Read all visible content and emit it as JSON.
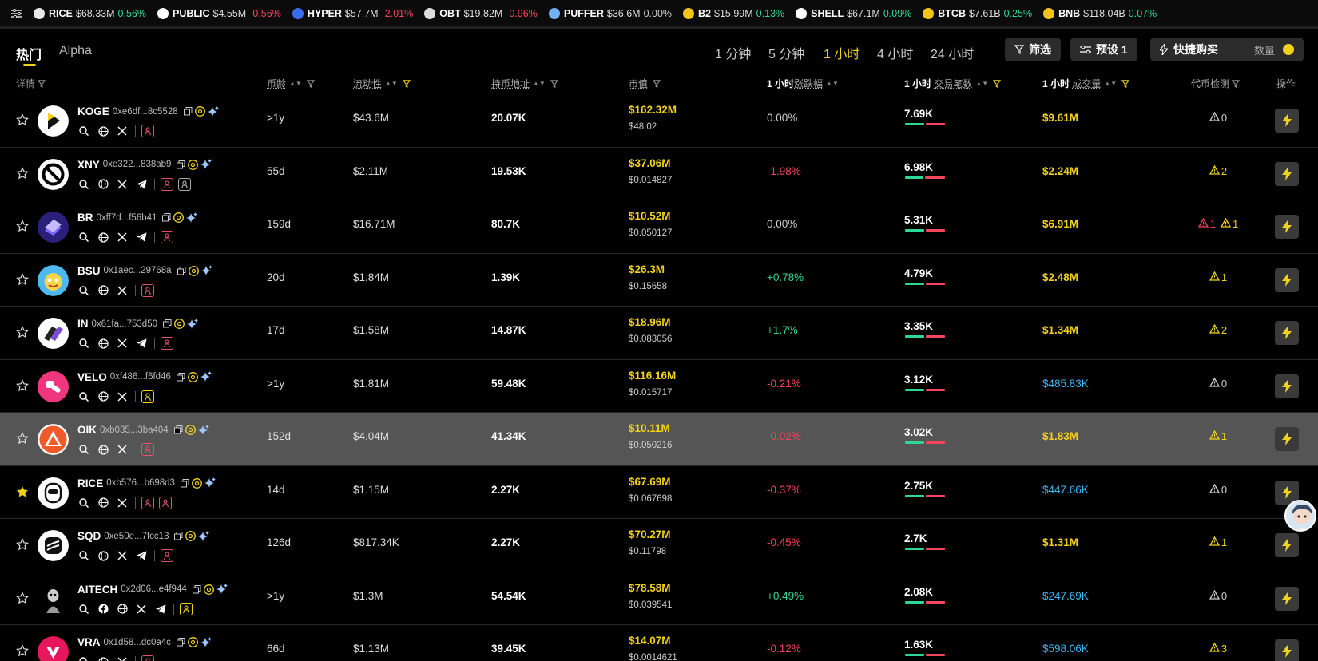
{
  "ticker": [
    {
      "sym": "RICE",
      "val": "$68.33M",
      "chg": "0.56%",
      "dir": "up",
      "color": "#e8e8e8"
    },
    {
      "sym": "PUBLIC",
      "val": "$4.55M",
      "chg": "-0.56%",
      "dir": "dn",
      "color": "#ffffff"
    },
    {
      "sym": "HYPER",
      "val": "$57.7M",
      "chg": "-2.01%",
      "dir": "dn",
      "color": "#3b6cf0"
    },
    {
      "sym": "OBT",
      "val": "$19.82M",
      "chg": "-0.96%",
      "dir": "dn",
      "color": "#dddddd"
    },
    {
      "sym": "PUFFER",
      "val": "$36.6M",
      "chg": "0.00%",
      "dir": "neu",
      "color": "#6fb1f5"
    },
    {
      "sym": "B2",
      "val": "$15.99M",
      "chg": "0.13%",
      "dir": "up",
      "color": "#f0c419"
    },
    {
      "sym": "SHELL",
      "val": "$67.1M",
      "chg": "0.09%",
      "dir": "up",
      "color": "#ffffff"
    },
    {
      "sym": "BTCB",
      "val": "$7.61B",
      "chg": "0.25%",
      "dir": "up",
      "color": "#f0c419"
    },
    {
      "sym": "BNB",
      "val": "$118.04B",
      "chg": "0.07%",
      "dir": "up",
      "color": "#f0c419"
    }
  ],
  "tabs": {
    "hot": "热门",
    "alpha": "Alpha"
  },
  "timeframes": [
    "1 分钟",
    "5 分钟",
    "1 小时",
    "4 小时",
    "24 小时"
  ],
  "active_timeframe": "1 小时",
  "buttons": {
    "filter": "筛选",
    "preset": "预设 1",
    "quick_buy": "快捷购买",
    "quantity": "数量"
  },
  "columns": {
    "detail": "详情",
    "age": "币龄",
    "liquidity": "流动性",
    "holders": "持币地址",
    "mcap": "市值",
    "change_prefix": "1 小时",
    "change": "涨跌幅",
    "tx_prefix": "1 小时",
    "tx": "交易笔数",
    "vol_prefix": "1 小时",
    "vol": "成交量",
    "check": "代币检测",
    "action": "操作"
  },
  "rows": [
    {
      "sym": "KOGE",
      "addr": "0xe6df...8c5528",
      "age": ">1y",
      "liq": "$43.6M",
      "holders": "20.07K",
      "mcap": "$162.32M",
      "price": "$48.02",
      "chg": "0.00%",
      "dir": "neu",
      "tx": "7.69K",
      "buy": 0.5,
      "vol": "$9.61M",
      "volc": "y",
      "warn": [
        {
          "c": "w",
          "n": "0"
        }
      ],
      "fav": false,
      "hl": false,
      "logo": "#ffffff",
      "tg": false,
      "boxes": [
        "r"
      ]
    },
    {
      "sym": "XNY",
      "addr": "0xe322...838ab9",
      "age": "55d",
      "liq": "$2.11M",
      "holders": "19.53K",
      "mcap": "$37.06M",
      "price": "$0.014827",
      "chg": "-1.98%",
      "dir": "dn",
      "tx": "6.98K",
      "buy": 0.48,
      "vol": "$2.24M",
      "volc": "y",
      "warn": [
        {
          "c": "y",
          "n": "2"
        }
      ],
      "fav": false,
      "hl": false,
      "logo": "#ffffff",
      "tg": true,
      "boxes": [
        "r",
        "w"
      ]
    },
    {
      "sym": "BR",
      "addr": "0xff7d...f56b41",
      "age": "159d",
      "liq": "$16.71M",
      "holders": "80.7K",
      "mcap": "$10.52M",
      "price": "$0.050127",
      "chg": "0.00%",
      "dir": "neu",
      "tx": "5.31K",
      "buy": 0.5,
      "vol": "$6.91M",
      "volc": "y",
      "warn": [
        {
          "c": "r",
          "n": "1"
        },
        {
          "c": "y",
          "n": "1"
        }
      ],
      "fav": false,
      "hl": false,
      "logo": "#2a1f7a",
      "tg": true,
      "boxes": [
        "r"
      ]
    },
    {
      "sym": "BSU",
      "addr": "0x1aec...29768a",
      "age": "20d",
      "liq": "$1.84M",
      "holders": "1.39K",
      "mcap": "$26.3M",
      "price": "$0.15658",
      "chg": "+0.78%",
      "dir": "up",
      "tx": "4.79K",
      "buy": 0.5,
      "vol": "$2.48M",
      "volc": "y",
      "warn": [
        {
          "c": "y",
          "n": "1"
        }
      ],
      "fav": false,
      "hl": false,
      "logo": "#4db8f0",
      "tg": false,
      "boxes": [
        "r"
      ]
    },
    {
      "sym": "IN",
      "addr": "0x61fa...753d50",
      "age": "17d",
      "liq": "$1.58M",
      "holders": "14.87K",
      "mcap": "$18.96M",
      "price": "$0.083056",
      "chg": "+1.7%",
      "dir": "up",
      "tx": "3.35K",
      "buy": 0.5,
      "vol": "$1.34M",
      "volc": "y",
      "warn": [
        {
          "c": "y",
          "n": "2"
        }
      ],
      "fav": false,
      "hl": false,
      "logo": "#ffffff",
      "tg": true,
      "boxes": [
        "r"
      ]
    },
    {
      "sym": "VELO",
      "addr": "0xf486...f6fd46",
      "age": ">1y",
      "liq": "$1.81M",
      "holders": "59.48K",
      "mcap": "$116.16M",
      "price": "$0.015717",
      "chg": "-0.21%",
      "dir": "dn",
      "tx": "3.12K",
      "buy": 0.5,
      "vol": "$485.83K",
      "volc": "b",
      "warn": [
        {
          "c": "w",
          "n": "0"
        }
      ],
      "fav": false,
      "hl": false,
      "logo": "#f0367e",
      "tg": false,
      "boxes": [
        "y"
      ]
    },
    {
      "sym": "OIK",
      "addr": "0xb035...3ba404",
      "age": "152d",
      "liq": "$4.04M",
      "holders": "41.34K",
      "mcap": "$10.11M",
      "price": "$0.050216",
      "chg": "-0.02%",
      "dir": "dn",
      "tx": "3.02K",
      "buy": 0.5,
      "vol": "$1.83M",
      "volc": "y",
      "warn": [
        {
          "c": "y",
          "n": "1"
        }
      ],
      "fav": false,
      "hl": true,
      "logo": "#ffffff",
      "tg": false,
      "boxes": [
        "r"
      ]
    },
    {
      "sym": "RICE",
      "addr": "0xb576...b698d3",
      "age": "14d",
      "liq": "$1.15M",
      "holders": "2.27K",
      "mcap": "$67.69M",
      "price": "$0.067698",
      "chg": "-0.37%",
      "dir": "dn",
      "tx": "2.75K",
      "buy": 0.5,
      "vol": "$447.66K",
      "volc": "b",
      "warn": [
        {
          "c": "w",
          "n": "0"
        }
      ],
      "fav": true,
      "hl": false,
      "logo": "#ffffff",
      "tg": false,
      "boxes": [
        "r",
        "r"
      ]
    },
    {
      "sym": "SQD",
      "addr": "0xe50e...7fcc13",
      "age": "126d",
      "liq": "$817.34K",
      "holders": "2.27K",
      "mcap": "$70.27M",
      "price": "$0.11798",
      "chg": "-0.45%",
      "dir": "dn",
      "tx": "2.7K",
      "buy": 0.5,
      "vol": "$1.31M",
      "volc": "y",
      "warn": [
        {
          "c": "y",
          "n": "1"
        }
      ],
      "fav": false,
      "hl": false,
      "logo": "#ffffff",
      "tg": true,
      "boxes": [
        "r"
      ]
    },
    {
      "sym": "AITECH",
      "addr": "0x2d06...e4f944",
      "age": ">1y",
      "liq": "$1.3M",
      "holders": "54.54K",
      "mcap": "$78.58M",
      "price": "$0.039541",
      "chg": "+0.49%",
      "dir": "up",
      "tx": "2.08K",
      "buy": 0.5,
      "vol": "$247.69K",
      "volc": "b",
      "warn": [
        {
          "c": "w",
          "n": "0"
        }
      ],
      "fav": false,
      "hl": false,
      "logo": "#111111",
      "tg": true,
      "fb": true,
      "boxes": [
        "y"
      ]
    },
    {
      "sym": "VRA",
      "addr": "0x1d58...dc0a4c",
      "age": "66d",
      "liq": "$1.13M",
      "holders": "39.45K",
      "mcap": "$14.07M",
      "price": "$0.0014621",
      "chg": "-0.12%",
      "dir": "dn",
      "tx": "1.63K",
      "buy": 0.5,
      "vol": "$598.06K",
      "volc": "b",
      "warn": [
        {
          "c": "y",
          "n": "3"
        }
      ],
      "fav": false,
      "hl": false,
      "logo": "#e8175d",
      "tg": false,
      "boxes": [
        "r"
      ]
    }
  ],
  "colors": {
    "accent": "#f0d21d",
    "up": "#2fd69a",
    "down": "#f5455c",
    "blue": "#3bb8f5"
  }
}
